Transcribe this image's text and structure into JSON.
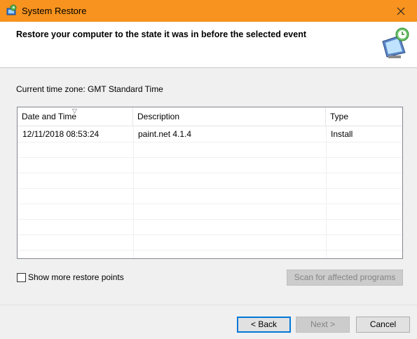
{
  "window": {
    "title": "System Restore",
    "accent_color": "#f7931e"
  },
  "header": {
    "title": "Restore your computer to the state it was in before the selected event"
  },
  "timezone": "Current time zone: GMT Standard Time",
  "table": {
    "columns": [
      "Date and Time",
      "Description",
      "Type"
    ],
    "rows": [
      {
        "date": "12/11/2018 08:53:24",
        "description": "paint.net 4.1.4",
        "type": "Install"
      }
    ]
  },
  "options": {
    "show_more_label": "Show more restore points",
    "show_more_checked": false
  },
  "buttons": {
    "scan": "Scan for affected programs",
    "back": "< Back",
    "next": "Next >",
    "cancel": "Cancel"
  }
}
